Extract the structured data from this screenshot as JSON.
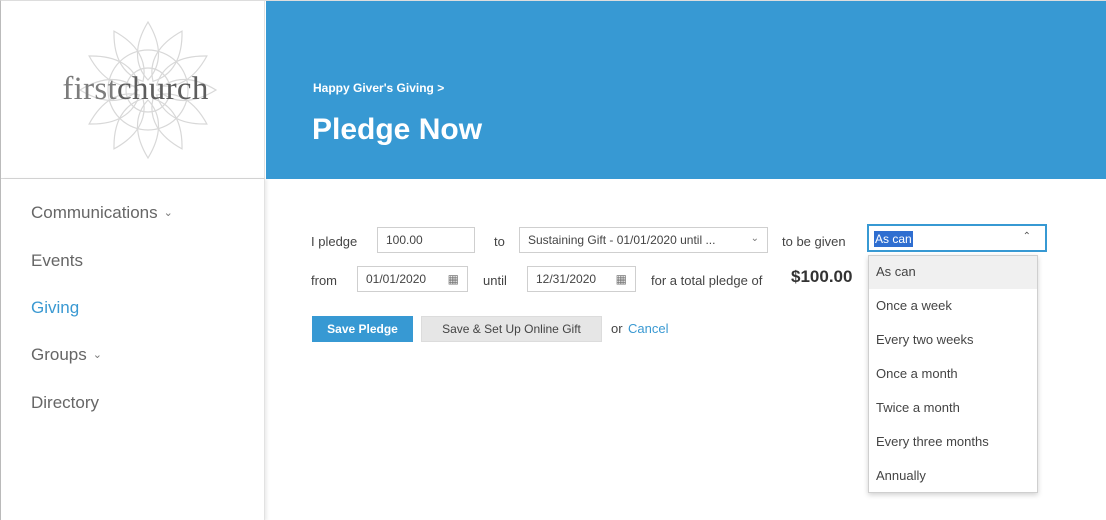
{
  "logo": {
    "text_light": "first",
    "text_dark": "church"
  },
  "nav": {
    "communications": "Communications",
    "events": "Events",
    "giving": "Giving",
    "groups": "Groups",
    "directory": "Directory"
  },
  "header": {
    "breadcrumb": "Happy Giver's Giving >",
    "title": "Pledge Now"
  },
  "form": {
    "i_pledge_label": "I pledge",
    "amount_value": "100.00",
    "to_label": "to",
    "fund_value": "Sustaining Gift - 01/01/2020 until ...",
    "to_be_given_label": "to be given",
    "frequency_value": "As can",
    "from_label": "from",
    "from_date": "01/01/2020",
    "until_label": "until",
    "until_date": "12/31/2020",
    "total_label": "for a total pledge of",
    "total_value": "$100.00"
  },
  "actions": {
    "save_pledge": "Save Pledge",
    "save_setup": "Save & Set Up Online Gift",
    "or": "or",
    "cancel": "Cancel"
  },
  "frequency_options": [
    "As can",
    "Once a week",
    "Every two weeks",
    "Once a month",
    "Twice a month",
    "Every three months",
    "Annually"
  ],
  "icons": {
    "chevron": "chevron-down-icon",
    "calendar": "calendar-icon"
  },
  "colors": {
    "brand_blue": "#3799d3",
    "link_blue": "#3a99d2",
    "selection_blue": "#2f6ed0"
  }
}
